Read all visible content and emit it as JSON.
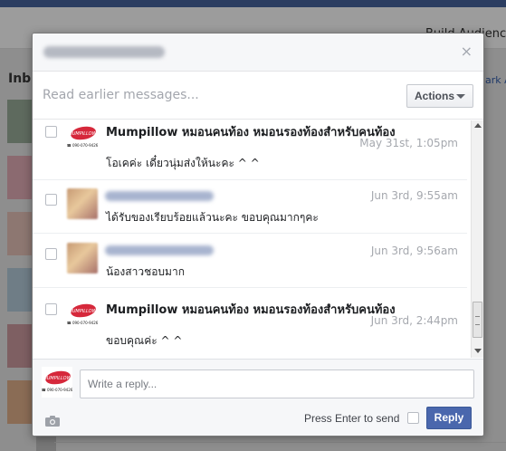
{
  "background": {
    "build_audience": "Build Audience",
    "inbox": "Inb",
    "mark": "ark A"
  },
  "dialog": {
    "read_earlier": "Read earlier messages...",
    "actions_label": "Actions",
    "close_symbol": "×"
  },
  "messages": [
    {
      "sender": "Mumpillow หมอนคนท้อง หมอนรองท้องสำหรับคนท้อง",
      "timestamp": "May 31st, 1:05pm",
      "text": "โอเคค่ะ  เดี๋ยวนุ่มส่งให้นะคะ  ^ ^"
    },
    {
      "sender": "",
      "timestamp": "Jun 3rd, 9:55am",
      "text": "ได้รับของเรียบร้อยแล้วนะคะ ขอบคุณมากๆคะ"
    },
    {
      "sender": "",
      "timestamp": "Jun 3rd, 9:56am",
      "text": "น้องสาวชอบมาก"
    },
    {
      "sender": "Mumpillow หมอนคนท้อง หมอนรองท้องสำหรับคนท้อง",
      "timestamp": "Jun 3rd, 2:44pm",
      "text": "ขอบคุณค่ะ  ^ ^"
    }
  ],
  "logo": {
    "brand": "MUMPILLOW",
    "phone": "☎ 090-070-9426"
  },
  "composer": {
    "placeholder": "Write a reply...",
    "press_enter": "Press Enter to send",
    "reply_label": "Reply"
  },
  "colors": {
    "accent": "#4a67ad",
    "logo_red": "#d6283b"
  }
}
